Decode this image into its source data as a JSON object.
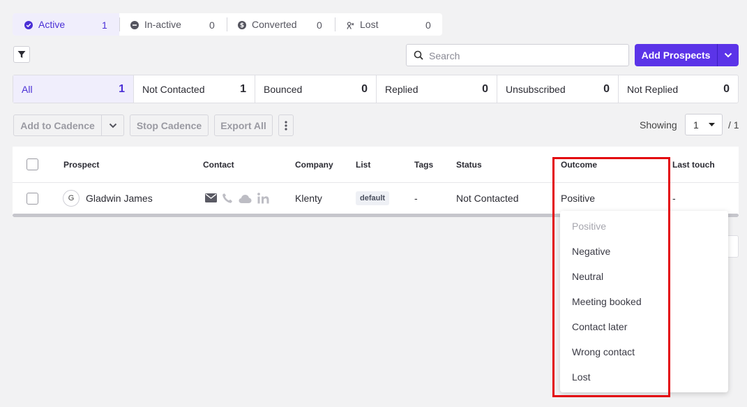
{
  "state_tabs": [
    {
      "label": "Active",
      "count": "1",
      "icon": "check-circle-icon"
    },
    {
      "label": "In-active",
      "count": "0",
      "icon": "minus-circle-icon"
    },
    {
      "label": "Converted",
      "count": "0",
      "icon": "dollar-circle-icon"
    },
    {
      "label": "Lost",
      "count": "0",
      "icon": "lost-icon"
    }
  ],
  "search": {
    "placeholder": "Search"
  },
  "add_prospects": {
    "label": "Add Prospects"
  },
  "status_filters": [
    {
      "label": "All",
      "count": "1"
    },
    {
      "label": "Not Contacted",
      "count": "1"
    },
    {
      "label": "Bounced",
      "count": "0"
    },
    {
      "label": "Replied",
      "count": "0"
    },
    {
      "label": "Unsubscribed",
      "count": "0"
    },
    {
      "label": "Not Replied",
      "count": "0"
    }
  ],
  "actions": {
    "add_to_cadence": "Add to Cadence",
    "stop_cadence": "Stop Cadence",
    "export_all": "Export All"
  },
  "pagination": {
    "showing_label": "Showing",
    "page": "1",
    "total": "/ 1"
  },
  "table": {
    "headers": [
      "Prospect",
      "Contact",
      "Company",
      "List",
      "Tags",
      "Status",
      "Outcome",
      "Last touch"
    ],
    "row": {
      "avatar_initial": "G",
      "prospect": "Gladwin James",
      "company": "Klenty",
      "list": "default",
      "tags": "-",
      "status": "Not Contacted",
      "outcome": "Positive",
      "last_touch": "-"
    }
  },
  "outcome_options": [
    "Positive",
    "Negative",
    "Neutral",
    "Meeting booked",
    "Contact later",
    "Wrong contact",
    "Lost"
  ],
  "colors": {
    "accent": "#5b34e8",
    "highlight": "#e3060e"
  }
}
